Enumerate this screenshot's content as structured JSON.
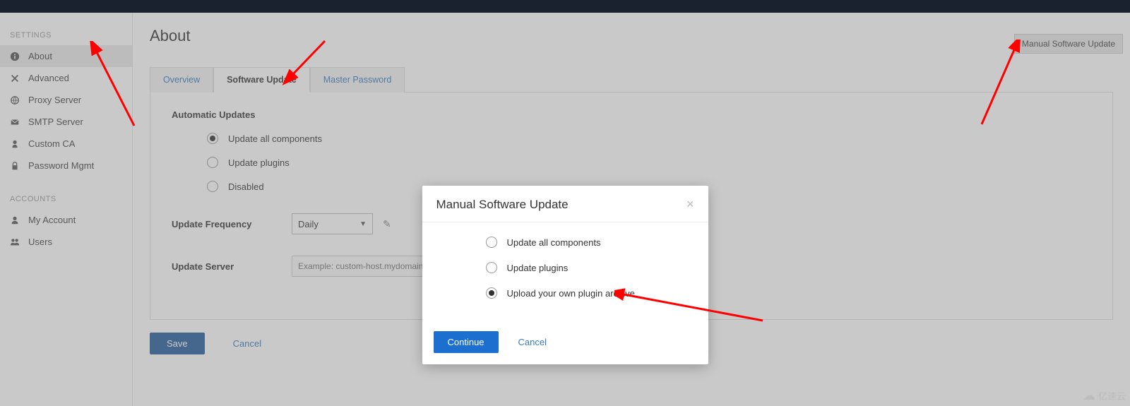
{
  "sidebar": {
    "section1_label": "SETTINGS",
    "items1": [
      {
        "label": "About",
        "icon": "ℹ",
        "active": true
      },
      {
        "label": "Advanced",
        "icon": "✖"
      },
      {
        "label": "Proxy Server",
        "icon": "🌐"
      },
      {
        "label": "SMTP Server",
        "icon": "✉"
      },
      {
        "label": "Custom CA",
        "icon": "👤"
      },
      {
        "label": "Password Mgmt",
        "icon": "🔒"
      }
    ],
    "section2_label": "ACCOUNTS",
    "items2": [
      {
        "label": "My Account",
        "icon": "👤"
      },
      {
        "label": "Users",
        "icon": "👥"
      }
    ]
  },
  "header": {
    "title": "About",
    "manual_button": "Manual Software Update"
  },
  "tabs": [
    {
      "label": "Overview",
      "active": false
    },
    {
      "label": "Software Update",
      "active": true
    },
    {
      "label": "Master Password",
      "active": false
    }
  ],
  "panel": {
    "automatic_title": "Automatic Updates",
    "auto_options": [
      {
        "label": "Update all components",
        "checked": true
      },
      {
        "label": "Update plugins",
        "checked": false
      },
      {
        "label": "Disabled",
        "checked": false
      }
    ],
    "freq_label": "Update Frequency",
    "freq_value": "Daily",
    "server_label": "Update Server",
    "server_placeholder": "Example: custom-host.mydomain.com"
  },
  "footer": {
    "save": "Save",
    "cancel": "Cancel"
  },
  "modal": {
    "title": "Manual Software Update",
    "options": [
      {
        "label": "Update all components",
        "checked": false
      },
      {
        "label": "Update plugins",
        "checked": false
      },
      {
        "label": "Upload your own plugin archive",
        "checked": true
      }
    ],
    "continue": "Continue",
    "cancel": "Cancel"
  },
  "watermark": "亿速云"
}
